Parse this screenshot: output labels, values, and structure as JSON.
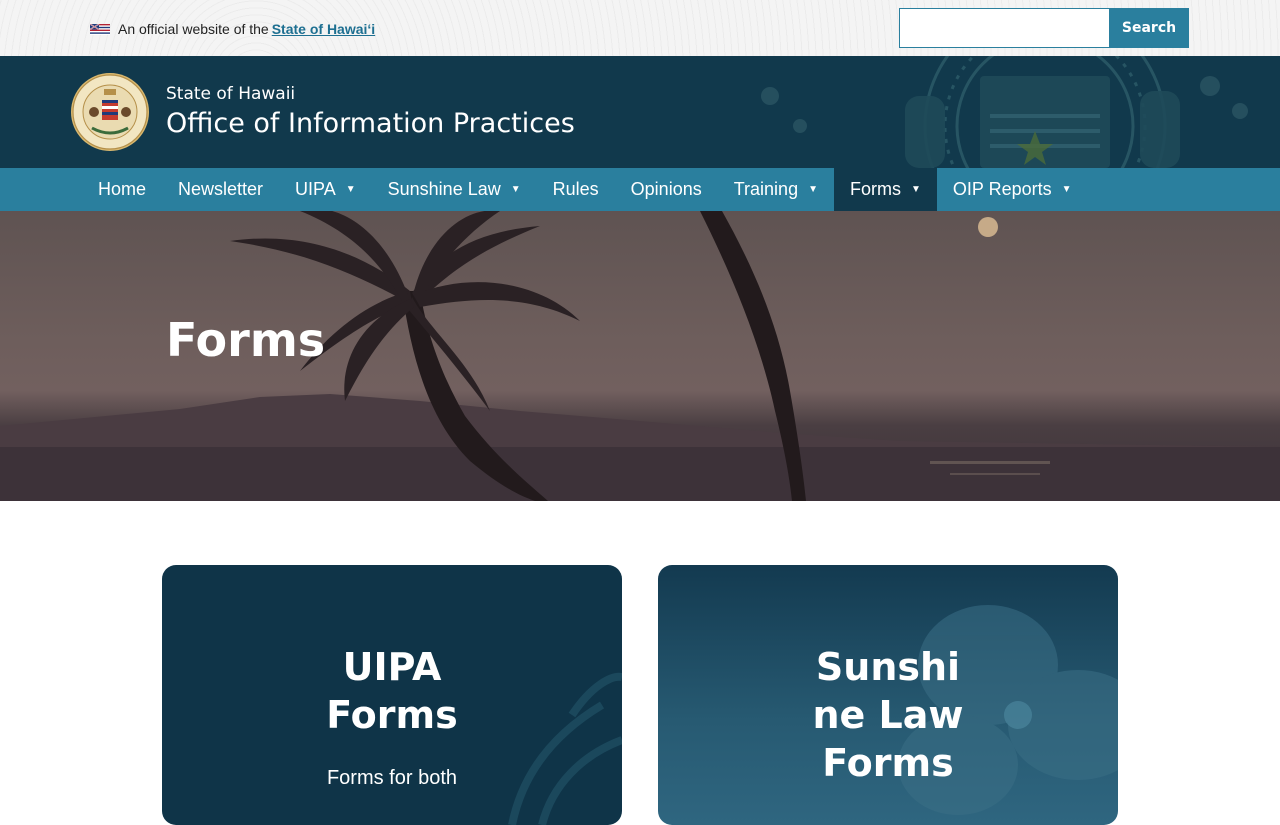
{
  "topbar": {
    "official_text": "An official website of the",
    "official_link": "State of Hawaiʻi",
    "search_placeholder": "",
    "search_button": "Search"
  },
  "header": {
    "subtitle": "State of Hawaii",
    "title": "Office of Information Practices"
  },
  "nav": {
    "items": [
      {
        "label": "Home",
        "dropdown": false
      },
      {
        "label": "Newsletter",
        "dropdown": false
      },
      {
        "label": "UIPA",
        "dropdown": true
      },
      {
        "label": "Sunshine Law",
        "dropdown": true
      },
      {
        "label": "Rules",
        "dropdown": false
      },
      {
        "label": "Opinions",
        "dropdown": false
      },
      {
        "label": "Training",
        "dropdown": true
      },
      {
        "label": "Forms",
        "dropdown": true
      },
      {
        "label": "OIP Reports",
        "dropdown": true
      }
    ],
    "caret": "▼",
    "active": "Forms"
  },
  "hero": {
    "title": "Forms"
  },
  "cards": [
    {
      "title_lines": [
        "UIPA",
        "Forms"
      ],
      "description": "Forms for both"
    },
    {
      "title_lines": [
        "Sunshi",
        "ne Law",
        "Forms"
      ],
      "description": ""
    }
  ],
  "colors": {
    "accent": "#2a7f9e",
    "header_bg": "#11394c",
    "link": "#1d6f91"
  }
}
